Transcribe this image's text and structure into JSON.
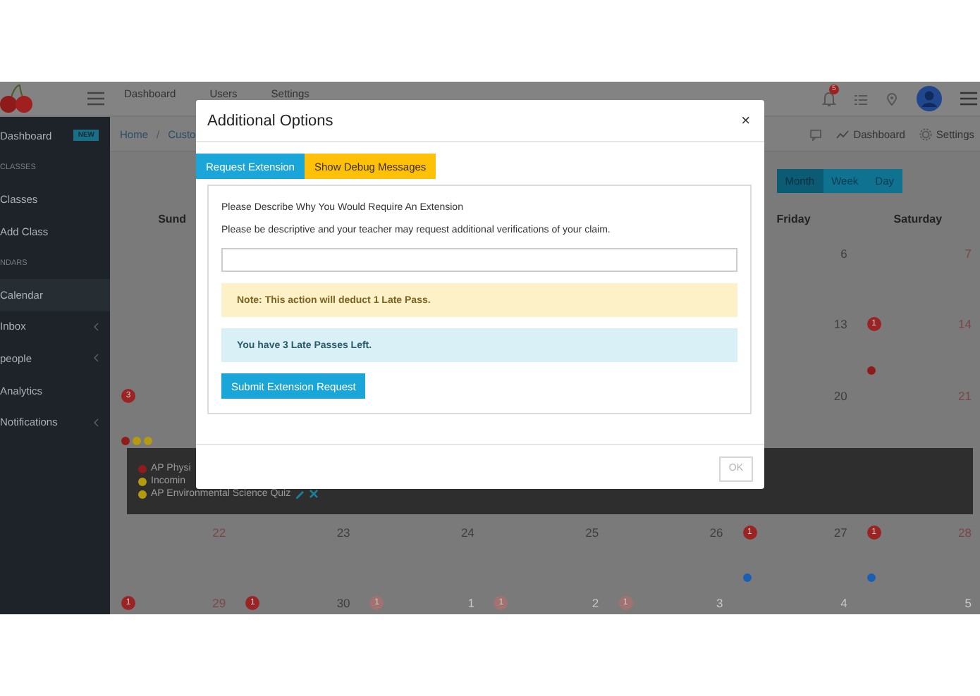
{
  "top_bar": {
    "nav": [
      "Dashboard",
      "Users",
      "Settings"
    ],
    "notification_badge": "5"
  },
  "sidebar": {
    "items": [
      {
        "kind": "link",
        "label": "Dashboard",
        "badge": "NEW",
        "selected": false,
        "expandable": false
      },
      {
        "kind": "header",
        "label": "CLASSES"
      },
      {
        "kind": "link",
        "label": "Classes",
        "selected": false,
        "expandable": false
      },
      {
        "kind": "link",
        "label": "Add Class",
        "selected": false,
        "expandable": false
      },
      {
        "kind": "header",
        "label": "NDARS"
      },
      {
        "kind": "link",
        "label": "Calendar",
        "selected": true,
        "expandable": false
      },
      {
        "kind": "link",
        "label": "Inbox",
        "selected": false,
        "expandable": true
      },
      {
        "kind": "link",
        "label": "people",
        "selected": false,
        "expandable": true
      },
      {
        "kind": "link",
        "label": "Analytics",
        "selected": false,
        "expandable": false
      },
      {
        "kind": "link",
        "label": "Notifications",
        "selected": false,
        "expandable": true
      }
    ]
  },
  "breadcrumb": {
    "items": [
      "Home",
      "Custo"
    ],
    "separator": "/",
    "actions": [
      "Dashboard",
      "Settings"
    ]
  },
  "calendar": {
    "view_buttons": [
      {
        "label": "Month",
        "selected": true
      },
      {
        "label": "Week",
        "selected": false
      },
      {
        "label": "Day",
        "selected": false
      }
    ],
    "weekdays": [
      {
        "label": "Sund",
        "kind": "sun"
      },
      {
        "label": "Friday",
        "kind": "fri"
      },
      {
        "label": "Saturday",
        "kind": "sat"
      }
    ],
    "weeks": [
      {
        "days": [
          {
            "kind": "fri",
            "day": "6"
          },
          {
            "kind": "sat",
            "day": "7"
          }
        ]
      },
      {
        "days": [
          {
            "kind": "fri",
            "day": "13"
          },
          {
            "kind": "sat",
            "day": "14",
            "badge": "1",
            "dots": [
              {
                "color": "#8e1c1c"
              }
            ]
          }
        ]
      },
      {
        "days": [
          {
            "kind": "sun",
            "badge": "3",
            "dots": [
              {
                "color": "#8e1c1c"
              },
              {
                "color": "#b39a10"
              },
              {
                "color": "#b39a10"
              }
            ]
          },
          {
            "kind": "fri",
            "day": "20"
          },
          {
            "kind": "sat",
            "day": "21"
          }
        ],
        "events": [
          {
            "title": "AP Physi",
            "color": "#8e1c1c",
            "editable": false
          },
          {
            "title": "Incomin",
            "color": "#b39a10",
            "editable": false
          },
          {
            "title": "AP Environmental Science Quiz",
            "color": "#b39a10",
            "editable": true
          }
        ]
      },
      {
        "days": [
          {
            "kind": "sun",
            "day": "22"
          },
          {
            "kind": "mon",
            "day": "23"
          },
          {
            "kind": "tue",
            "day": "24"
          },
          {
            "kind": "wed",
            "day": "25"
          },
          {
            "kind": "thu",
            "day": "26"
          },
          {
            "kind": "fri",
            "day": "27",
            "badge": "1",
            "dots": [
              {
                "color": "#1a5fb0"
              }
            ]
          },
          {
            "kind": "sat",
            "day": "28",
            "badge": "1",
            "dots": [
              {
                "color": "#1a5fb0"
              }
            ]
          }
        ]
      },
      {
        "days": [
          {
            "kind": "sun",
            "day": "29",
            "badge": "1"
          },
          {
            "kind": "mon",
            "day": "30",
            "badge": "1"
          },
          {
            "kind": "tue",
            "day": "1",
            "badge": "1",
            "muted": true
          },
          {
            "kind": "wed",
            "day": "2",
            "badge": "1",
            "muted": true
          },
          {
            "kind": "thu",
            "day": "3",
            "badge": "1",
            "muted": true
          },
          {
            "kind": "fri",
            "day": "4",
            "muted": true
          },
          {
            "kind": "sat",
            "day": "5",
            "muted": true
          }
        ]
      }
    ]
  },
  "modal": {
    "title": "Additional Options",
    "close": "×",
    "tabs": [
      {
        "label": "Request Extension",
        "selected": true
      },
      {
        "label": "Show Debug Messages",
        "selected": false
      }
    ],
    "heading": "Please Describe Why You Would Require An Extension",
    "hint": "Please be descriptive and your teacher may request additional verifications of your claim.",
    "alerts": [
      {
        "kind": "warning",
        "text": "Note: This action will deduct 1 Late Pass."
      },
      {
        "kind": "info",
        "text": "You have 3 Late Passes Left."
      }
    ],
    "submit": "Submit Extension Request",
    "ok": {
      "label": "OK",
      "disabled": true
    }
  }
}
